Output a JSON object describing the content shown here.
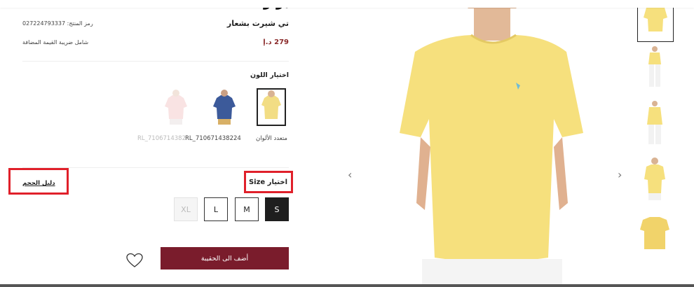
{
  "product": {
    "brand": "بولو",
    "name": "تي شيرت بشعار",
    "sku_label": "رمز المنتج: 027224793337",
    "price": "279 د.إ",
    "vat_note": "شامل ضريبة القيمة المضافة"
  },
  "color": {
    "title": "اختيار اللون",
    "swatches": [
      {
        "label": "متعدد الألوان",
        "color": "#f2dd84",
        "selected": true
      },
      {
        "label": "RL_710671438224",
        "color": "#3c5a9a",
        "selected": false
      },
      {
        "label": "RL_710671438224",
        "color": "#f4c9c9",
        "selected": false
      }
    ]
  },
  "size": {
    "title": "اختيار Size",
    "guide": "دليل الحجم",
    "options": [
      {
        "label": "S",
        "state": "selected"
      },
      {
        "label": "M",
        "state": "available"
      },
      {
        "label": "L",
        "state": "available"
      },
      {
        "label": "XL",
        "state": "unavailable"
      }
    ]
  },
  "actions": {
    "add_to_bag": "أضف الى الحقيبة"
  },
  "gallery": {
    "prev_arrow": "‹",
    "next_arrow": "›",
    "shirt_color": "#f6e07d"
  },
  "colors": {
    "accent": "#7a1c2c",
    "highlight": "#e0202a",
    "price": "#8a2a2a"
  }
}
